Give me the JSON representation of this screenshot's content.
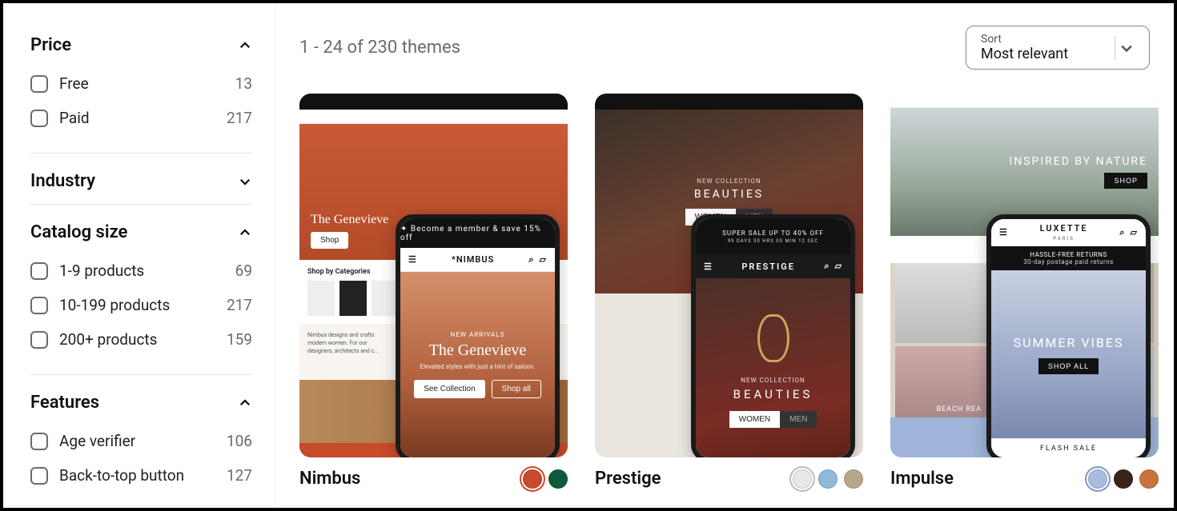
{
  "sidebar": {
    "groups": [
      {
        "title": "Price",
        "expanded": true,
        "options": [
          {
            "label": "Free",
            "count": 13
          },
          {
            "label": "Paid",
            "count": 217
          }
        ]
      },
      {
        "title": "Industry",
        "expanded": false,
        "options": []
      },
      {
        "title": "Catalog size",
        "expanded": true,
        "options": [
          {
            "label": "1-9 products",
            "count": 69
          },
          {
            "label": "10-199 products",
            "count": 217
          },
          {
            "label": "200+ products",
            "count": 159
          }
        ]
      },
      {
        "title": "Features",
        "expanded": true,
        "options": [
          {
            "label": "Age verifier",
            "count": 106
          },
          {
            "label": "Back-to-top button",
            "count": 127
          }
        ]
      }
    ]
  },
  "results": {
    "count_text": "1 - 24 of 230 themes"
  },
  "sort": {
    "label": "Sort",
    "value": "Most relevant"
  },
  "themes": [
    {
      "name": "Nimbus",
      "swatches": [
        "#c74a2a",
        "#0f5a3a"
      ],
      "brand": "*NIMBUS",
      "promo": "✦ Become a member & save 15% off",
      "hero_tag": "NEW ARRIVALS",
      "hero_title": "The Genevieve",
      "hero_sub": "Elevated styles with just a hint of saloon.",
      "cta1": "See Collection",
      "cta2": "Shop all",
      "desktop_title": "The Genevieve",
      "desktop_section": "Shop by Categories",
      "colors": {
        "bg": "#c95a36",
        "accent": "#c74a2a"
      }
    },
    {
      "name": "Prestige",
      "swatches": [
        "#e8e8e8",
        "#8fb8d9",
        "#b8a88a"
      ],
      "brand": "PRESTIGE",
      "promo": "SUPER SALE UP TO 40% OFF",
      "countdown": "99 DAYS  30 HRS  00 MIN  12 SEC",
      "hero_tag": "NEW COLLECTION",
      "hero_title": "BEAUTIES",
      "cta1": "WOMEN",
      "cta2": "MEN",
      "colors": {
        "bg": "#5a3a30",
        "accent": "#7a2c24"
      }
    },
    {
      "name": "Impulse",
      "swatches": [
        "#a8bce0",
        "#3a2418",
        "#c9743c"
      ],
      "brand": "LUXETTE",
      "brand_sub": "PARIS",
      "promo": "HASSLE-FREE RETURNS",
      "promo_sub": "30-day postage paid returns",
      "hero_title": "SUMMER VIBES",
      "cta1": "SHOP ALL",
      "desktop_hero": "INSPIRED BY NATURE",
      "desktop_section": "FLASH SALE",
      "tile1": "BEACH REA",
      "footer_strip": "FLASH SALE",
      "colors": {
        "bg": "#a8b8c8",
        "accent": "#9fb4d8"
      }
    }
  ]
}
